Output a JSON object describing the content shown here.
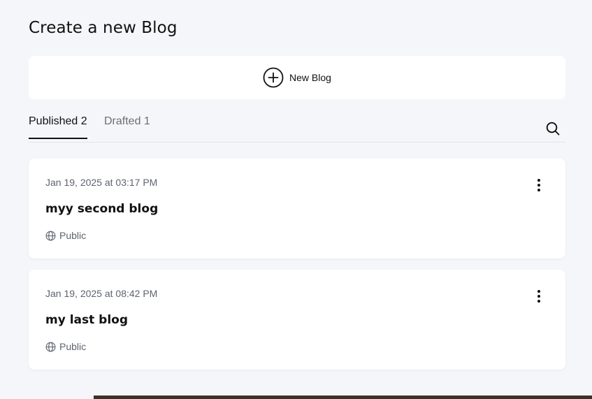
{
  "page": {
    "title": "Create a new Blog"
  },
  "new_blog": {
    "label": "New Blog",
    "icon": "plus-circle-icon"
  },
  "tabs": [
    {
      "label": "Published 2",
      "active": true
    },
    {
      "label": "Drafted 1",
      "active": false
    }
  ],
  "search": {
    "icon": "search-icon"
  },
  "blogs": [
    {
      "date": "Jan 19, 2025 at 03:17 PM",
      "title": "myy second blog",
      "visibility": "Public"
    },
    {
      "date": "Jan 19, 2025 at 08:42 PM",
      "title": "my last blog",
      "visibility": "Public"
    }
  ],
  "colors": {
    "background": "#f5f6fa",
    "card": "#ffffff",
    "muted": "#5e6370",
    "text": "#111111"
  }
}
